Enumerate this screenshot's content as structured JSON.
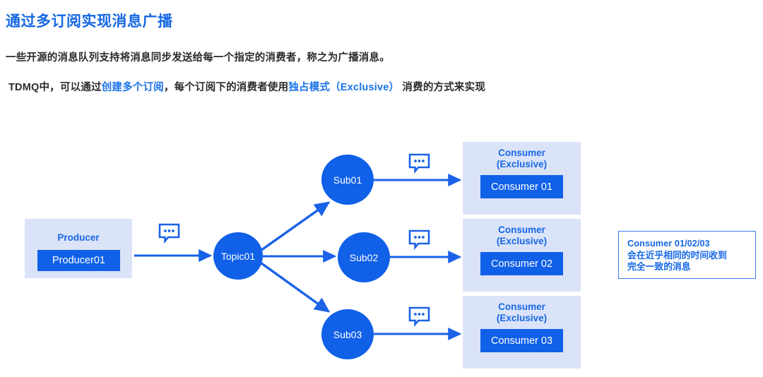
{
  "page": {
    "title": "通过多订阅实现消息广播",
    "paragraph_1": "一些开源的消息队列支持将消息同步发送给每一个指定的消费者，称之为广播消息。",
    "paragraph_2": {
      "part_1": "TDMQ中，可以通过",
      "highlight_1": "创建多个订阅",
      "part_2": "，每个订阅下的消费者使用",
      "highlight_2": "独占模式（Exclusive）",
      "part_3": " 消费的方式来实现"
    }
  },
  "colors": {
    "accent_blue": "#1668e3",
    "node_blue": "#1060e8",
    "panel_bg": "#dbe3f9",
    "text_dark": "#2b2b2b",
    "note_border": "#3d7bea"
  },
  "diagram": {
    "producer": {
      "panel_label": "Producer",
      "chip_label": "Producer01"
    },
    "topic": {
      "label": "Topic01"
    },
    "subscriptions": [
      {
        "label": "Sub01"
      },
      {
        "label": "Sub02"
      },
      {
        "label": "Sub03"
      }
    ],
    "consumers": [
      {
        "title_line_1": "Consumer",
        "title_line_2": "(Exclusive)",
        "chip_label": "Consumer 01"
      },
      {
        "title_line_1": "Consumer",
        "title_line_2": "(Exclusive)",
        "chip_label": "Consumer 02"
      },
      {
        "title_line_1": "Consumer",
        "title_line_2": "(Exclusive)",
        "chip_label": "Consumer 03"
      }
    ],
    "message_icon_name": "message-bubble-icon",
    "note": {
      "line_1": "Consumer 01/02/03",
      "line_2": "会在近乎相同的时间收到",
      "line_3": "完全一致的消息"
    }
  }
}
